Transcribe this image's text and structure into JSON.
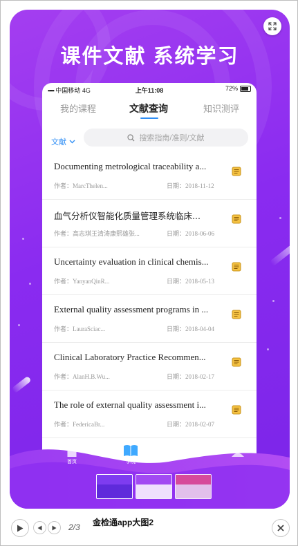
{
  "headline": "课件文献 系统学习",
  "phone": {
    "status": {
      "carrier": "中国移动",
      "network": "4G",
      "time": "上午11:08",
      "battery": "72%"
    },
    "tabs": [
      {
        "label": "我的课程",
        "active": false
      },
      {
        "label": "文献查询",
        "active": true
      },
      {
        "label": "知识测评",
        "active": false
      }
    ],
    "filter": {
      "label": "文献"
    },
    "search": {
      "placeholder": "搜索指南/准则/文献"
    },
    "author_prefix": "作者：",
    "date_prefix": "日期：",
    "items": [
      {
        "title": "Documenting metrological traceability a...",
        "author": "MarcThelen...",
        "date": "2018-11-12"
      },
      {
        "title": "血气分析仪智能化质量管理系统临床...",
        "author": "高志琪王清涛康熙雄张...",
        "date": "2018-06-06"
      },
      {
        "title": "Uncertainty evaluation in clinical chemis...",
        "author": "YanyanQinR...",
        "date": "2018-05-13"
      },
      {
        "title": "External quality assessment programs in ...",
        "author": "LauraSciac...",
        "date": "2018-04-04"
      },
      {
        "title": "Clinical Laboratory Practice Recommen...",
        "author": "AlanH.B.Wu...",
        "date": "2018-02-17"
      },
      {
        "title": "The role of external quality assessment i...",
        "author": "FedericaBr...",
        "date": "2018-02-07"
      }
    ],
    "nav": [
      {
        "label": "首页",
        "icon": "home-icon"
      },
      {
        "label": "学院",
        "icon": "book-icon"
      },
      {
        "label": "",
        "icon": "planet-icon"
      },
      {
        "label": "",
        "icon": "user-icon"
      }
    ]
  },
  "gallery": {
    "counter": "2/3",
    "caption": "金检通app大图2"
  },
  "colors": {
    "purple_start": "#a43ef0",
    "purple_end": "#7b25e8",
    "accent_blue": "#2f8ef5",
    "doc_icon": "#f5c242"
  }
}
